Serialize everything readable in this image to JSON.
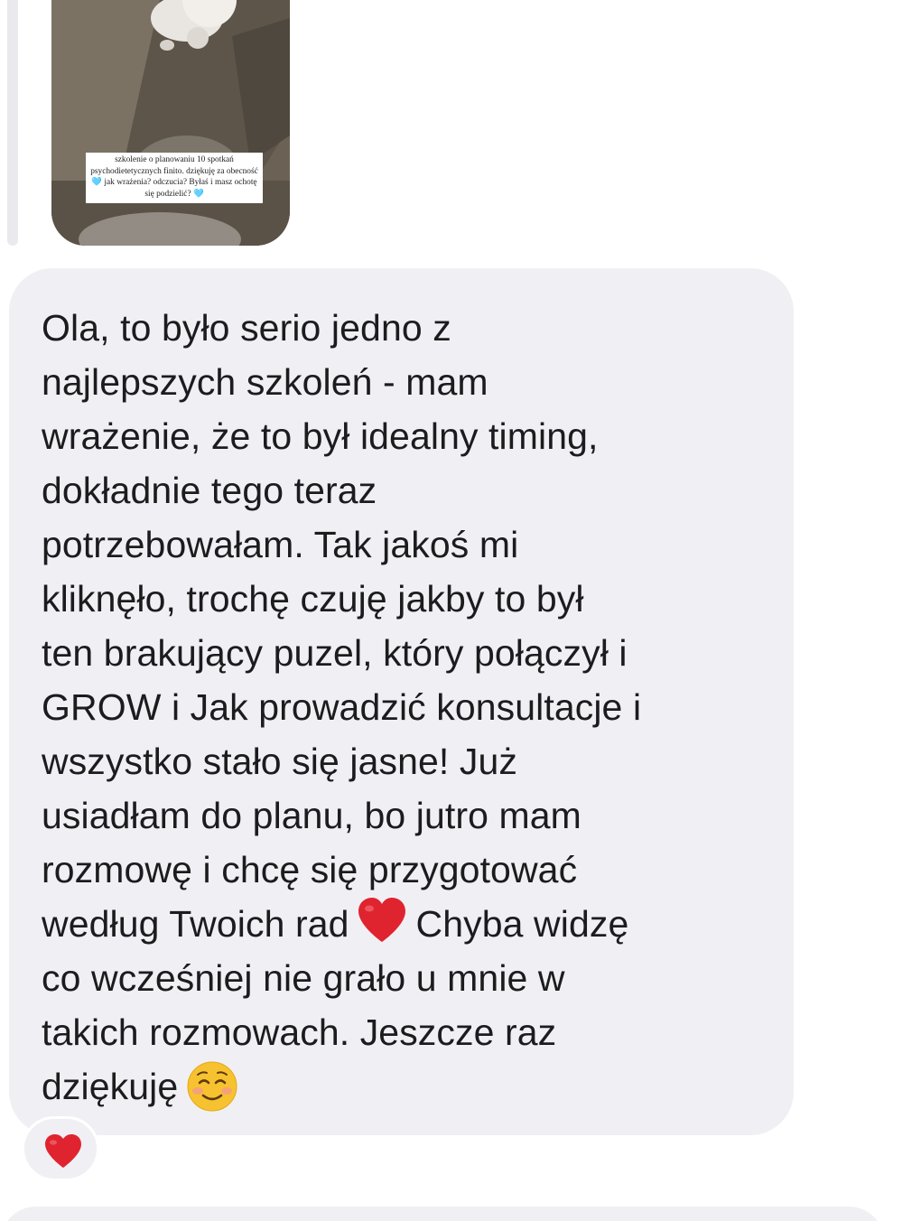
{
  "story": {
    "caption": "szkolenie o planowaniu 10 spotkań psychodietetycznych finito. dziękuję za obecność 🩵 jak wrażenia? odczucia? Byłaś i masz ochotę się podzielić? 🩵"
  },
  "message": {
    "lines": [
      "Ola, to było serio jedno z",
      "najlepszych szkoleń - mam",
      "wrażenie, że to był idealny timing,",
      "dokładnie tego teraz",
      "potrzebowałam. Tak jakoś mi",
      "kliknęło, trochę czuję jakby to był",
      "ten brakujący puzel, który połączył i",
      "GROW i Jak prowadzić konsultacje i",
      "wszystko stało się jasne! Już",
      "usiadłam do planu, bo jutro mam",
      "rozmowę i chcę się przygotować",
      "według Twoich rad",
      "Chyba widzę",
      "co wcześniej nie grało u mnie w",
      "takich rozmowach. Jeszcze raz",
      "dziękuję"
    ],
    "emoji_1": "heart-emoji",
    "emoji_2": "smiling-face-emoji"
  },
  "reaction": {
    "emoji": "heart-emoji"
  },
  "colors": {
    "bubble_bg": "#f0f0f4",
    "text": "#1c1c1e",
    "heart": "#e0242f",
    "smile": "#f7c22f"
  }
}
